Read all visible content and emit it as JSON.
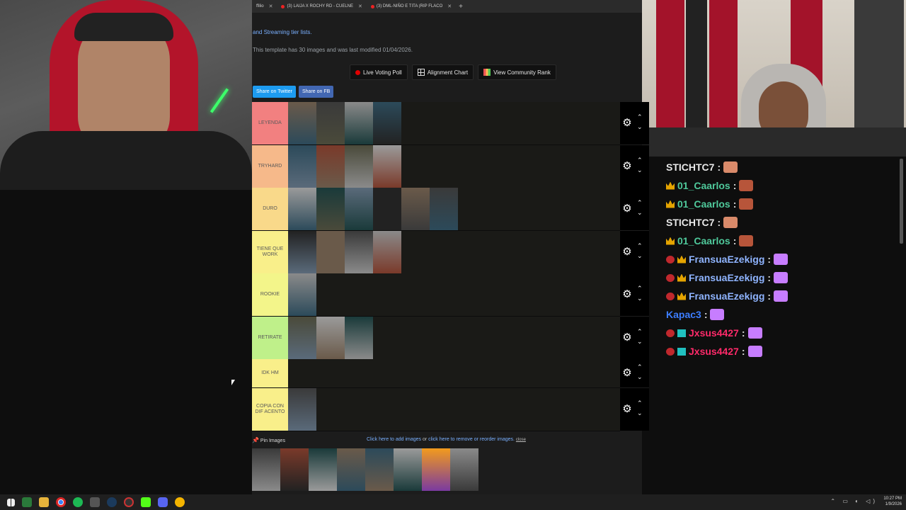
{
  "browser": {
    "tabs": [
      {
        "label": "ffilio"
      },
      {
        "label": "(3) LAIJA X ROCHY RD - CUELNE"
      },
      {
        "label": "(3) DML-NIÑO E TITA (RIP FLACO"
      }
    ],
    "new_tab": "+"
  },
  "page": {
    "intro_text": "and Streaming tier lists.",
    "meta_text": "This template has 30 images and was last modified 01/04/2026.",
    "buttons": {
      "live_poll": "Live Voting Poll",
      "alignment": "Alignment Chart",
      "community": "View Community Rank"
    },
    "share": {
      "twitter": "Share on Twitter",
      "fb": "Share on FB"
    },
    "tiers": [
      {
        "label": "LEYENDA",
        "color": "#f28080",
        "images": 4
      },
      {
        "label": "TRYHARD",
        "color": "#f6b98a",
        "images": 4
      },
      {
        "label": "DURO",
        "color": "#f9d98a",
        "images": 6
      },
      {
        "label": "TIENE QUE WORK",
        "color": "#f9ef8a",
        "images": 4
      },
      {
        "label": "ROOKIE",
        "color": "#f3f58a",
        "images": 1
      },
      {
        "label": "RETIRATE",
        "color": "#bff08a",
        "images": 3
      },
      {
        "label": "IDK HM",
        "color": "#f9ef8a",
        "images": 0
      },
      {
        "label": "COPIA CON DIF ACENTO",
        "color": "#f9ef8a",
        "images": 1
      }
    ],
    "pin": {
      "label": "Pin Images",
      "add_text": "Click here to add images",
      "or_text": " or ",
      "remove_text": "click here to remove or reorder images.",
      "close": "close"
    },
    "pool_images": 8
  },
  "chat": {
    "messages": [
      {
        "user": "STICHTC7",
        "color": "#e8e8e8",
        "badges": [],
        "emote_color": "#d98a6a"
      },
      {
        "user": "01_Caarlos",
        "color": "#4fc99b",
        "badges": [
          "crown"
        ],
        "emote_color": "#b7553a"
      },
      {
        "user": "01_Caarlos",
        "color": "#4fc99b",
        "badges": [
          "crown"
        ],
        "emote_color": "#b7553a"
      },
      {
        "user": "STICHTC7",
        "color": "#e8e8e8",
        "badges": [],
        "emote_color": "#d98a6a"
      },
      {
        "user": "01_Caarlos",
        "color": "#4fc99b",
        "badges": [
          "crown"
        ],
        "emote_color": "#b7553a"
      },
      {
        "user": "FransuaEzekigg",
        "color": "#8fb4ff",
        "badges": [
          "red",
          "crown"
        ],
        "emote_color": "#c77dff"
      },
      {
        "user": "FransuaEzekigg",
        "color": "#8fb4ff",
        "badges": [
          "red",
          "crown"
        ],
        "emote_color": "#c77dff"
      },
      {
        "user": "FransuaEzekigg",
        "color": "#8fb4ff",
        "badges": [
          "red",
          "crown"
        ],
        "emote_color": "#c77dff"
      },
      {
        "user": "Kapac3",
        "color": "#3d7dff",
        "badges": [],
        "emote_color": "#c77dff"
      },
      {
        "user": "Jxsus4427",
        "color": "#ff2a6a",
        "badges": [
          "red",
          "grid"
        ],
        "emote_color": "#c77dff"
      },
      {
        "user": "Jxsus4427",
        "color": "#ff2a6a",
        "badges": [
          "red",
          "grid"
        ],
        "emote_color": "#c77dff"
      }
    ]
  },
  "taskbar": {
    "time": "10:27 PM",
    "date": "1/9/2026"
  },
  "colors": {
    "twitter": "#1d9bf0",
    "fb": "#4267b2",
    "live_dot": "#e00000"
  }
}
